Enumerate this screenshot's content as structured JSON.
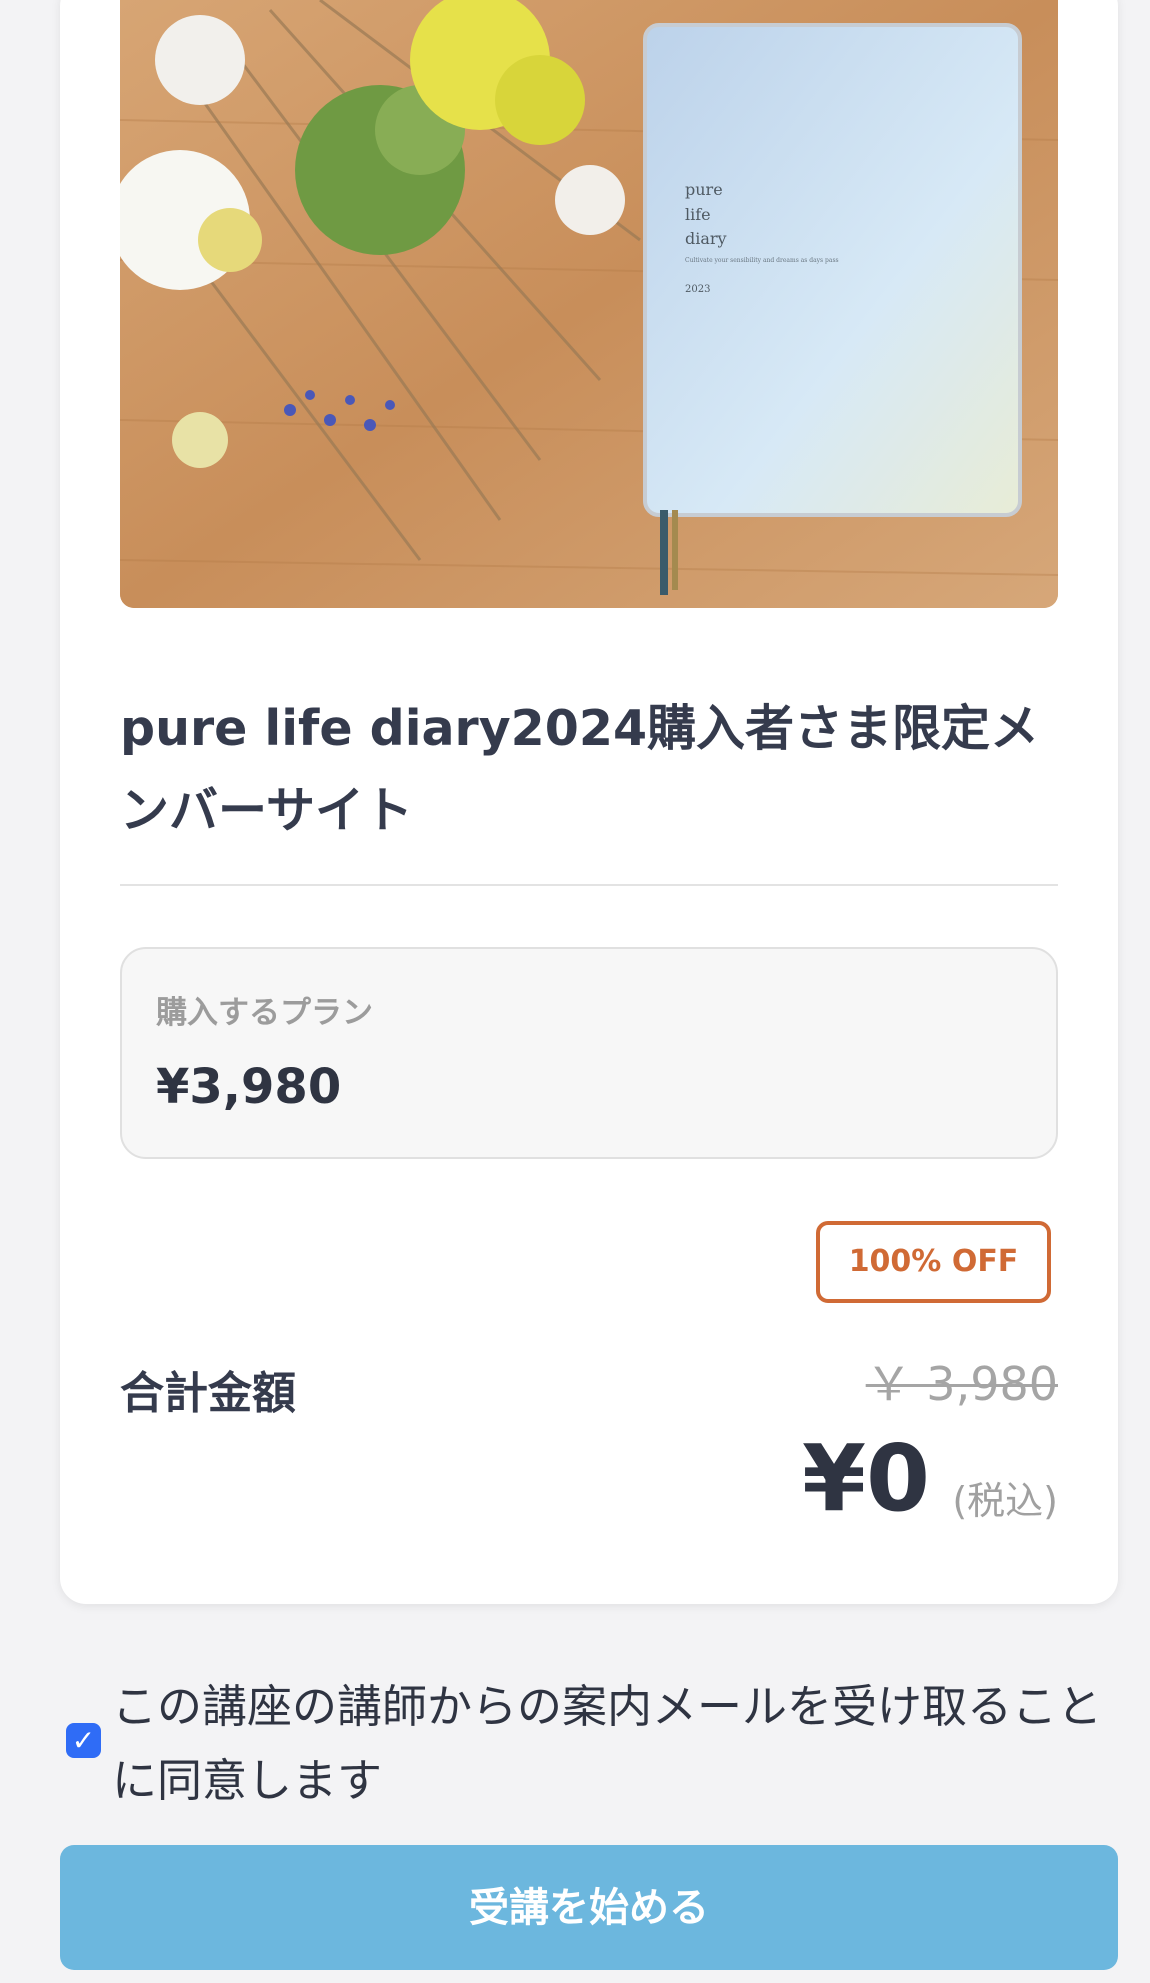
{
  "course": {
    "title": "pure life diary2024購入者さま限定メンバーサイト",
    "hero_image": {
      "book_title_lines": [
        "pure",
        "life",
        "diary"
      ],
      "book_year": "2023",
      "book_subtitle": "Cultivate your sensibility and dreams as days pass"
    }
  },
  "plan": {
    "label": "購入するプラン",
    "price": "¥3,980"
  },
  "discount": {
    "badge": "100% OFF"
  },
  "total": {
    "label": "合計金額",
    "original_price": "￥ 3,980",
    "final_price": "¥0",
    "tax_note": "(税込)"
  },
  "consent": {
    "checked": true,
    "text": "この講座の講師からの案内メールを受け取ることに同意します"
  },
  "submit": {
    "label": "受講を始める"
  },
  "colors": {
    "accent": "#6cb7de",
    "badge": "#d06a35",
    "checkbox": "#2f6cf6"
  }
}
